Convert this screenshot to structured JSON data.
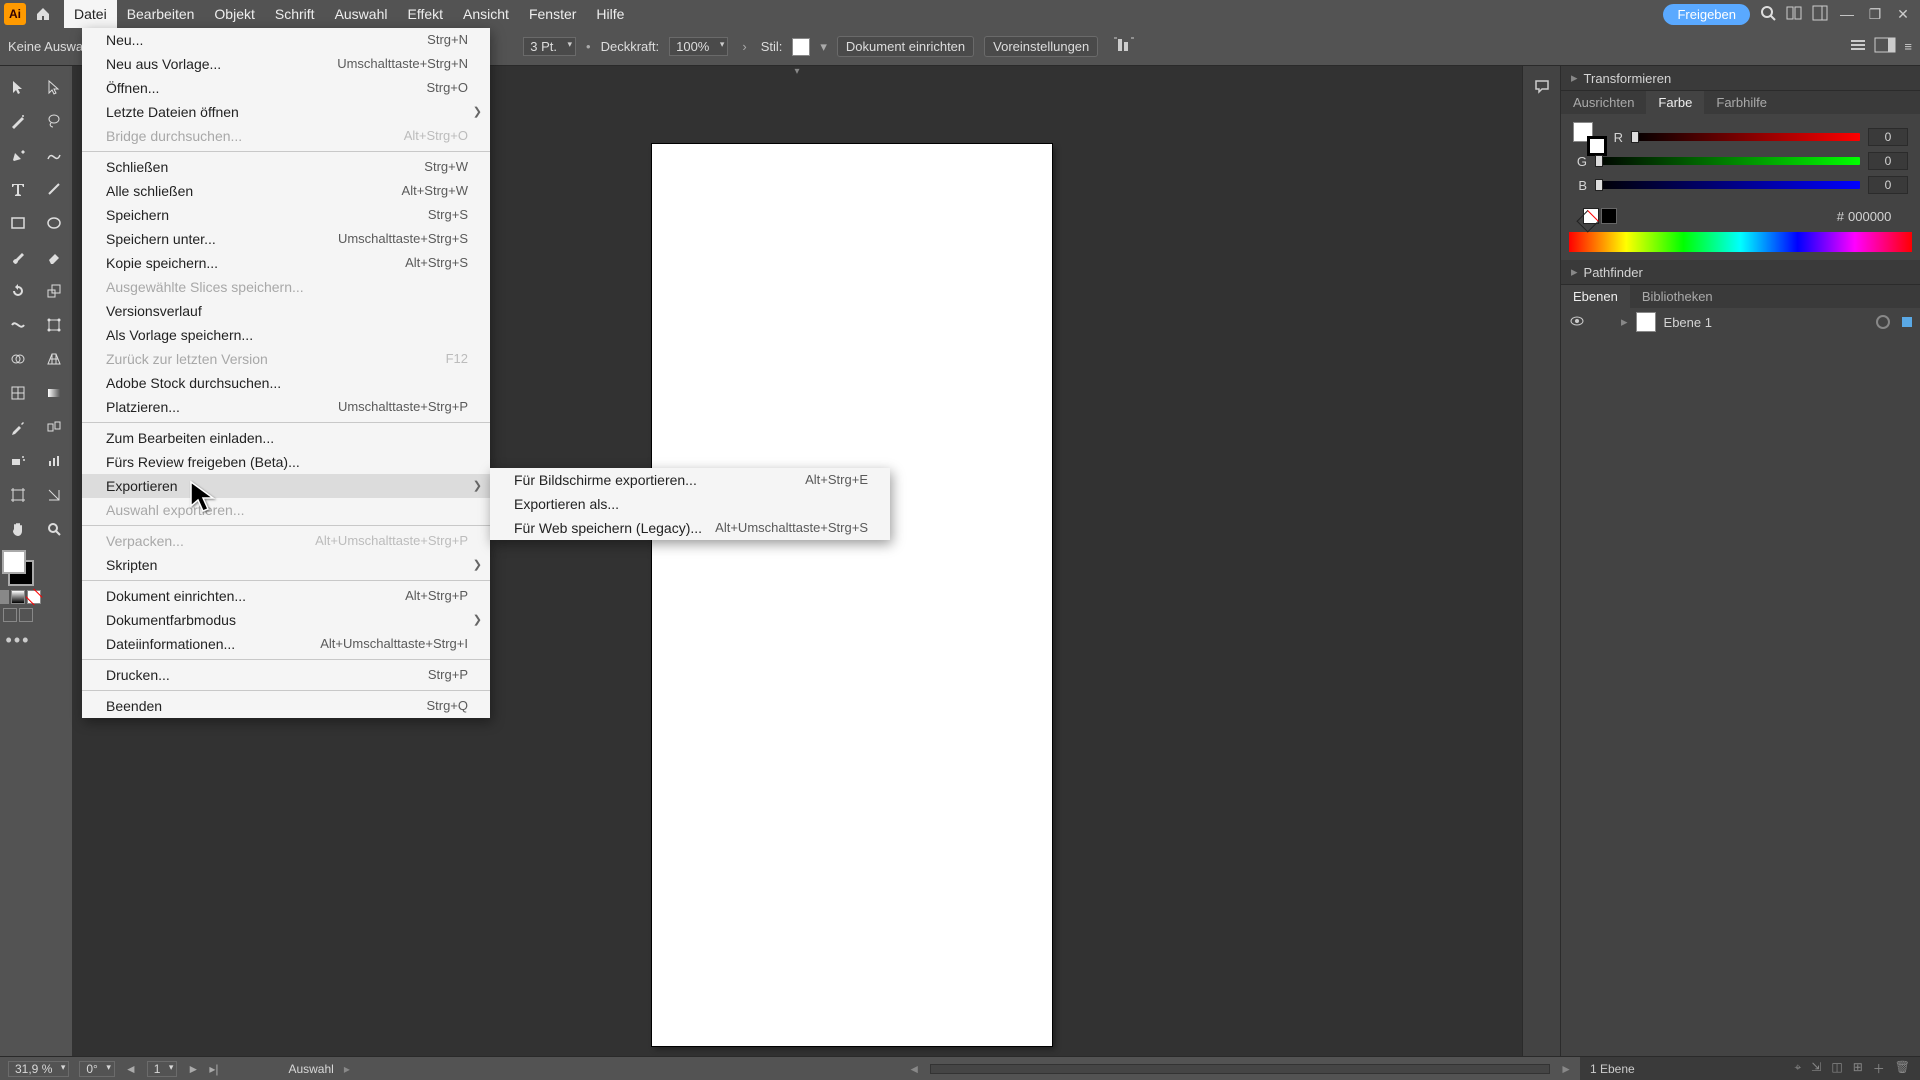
{
  "menubar": {
    "items": [
      "Datei",
      "Bearbeiten",
      "Objekt",
      "Schrift",
      "Auswahl",
      "Effekt",
      "Ansicht",
      "Fenster",
      "Hilfe"
    ],
    "share_label": "Freigeben"
  },
  "controlbar": {
    "no_selection": "Keine Auswahl",
    "stroke_val": "3 Pt.",
    "opacity_label": "Deckkraft:",
    "opacity_val": "100%",
    "style_label": "Stil:",
    "doc_setup": "Dokument einrichten",
    "prefs": "Voreinstellungen"
  },
  "file_menu": [
    {
      "label": "Neu...",
      "short": "Strg+N"
    },
    {
      "label": "Neu aus Vorlage...",
      "short": "Umschalttaste+Strg+N"
    },
    {
      "label": "Öffnen...",
      "short": "Strg+O"
    },
    {
      "label": "Letzte Dateien öffnen",
      "short": "",
      "sub": true
    },
    {
      "label": "Bridge durchsuchen...",
      "short": "Alt+Strg+O",
      "disabled": true
    },
    {
      "sep": true
    },
    {
      "label": "Schließen",
      "short": "Strg+W"
    },
    {
      "label": "Alle schließen",
      "short": "Alt+Strg+W"
    },
    {
      "label": "Speichern",
      "short": "Strg+S"
    },
    {
      "label": "Speichern unter...",
      "short": "Umschalttaste+Strg+S"
    },
    {
      "label": "Kopie speichern...",
      "short": "Alt+Strg+S"
    },
    {
      "label": "Ausgewählte Slices speichern...",
      "short": "",
      "disabled": true
    },
    {
      "label": "Versionsverlauf",
      "short": ""
    },
    {
      "label": "Als Vorlage speichern...",
      "short": ""
    },
    {
      "label": "Zurück zur letzten Version",
      "short": "F12",
      "disabled": true
    },
    {
      "label": "Adobe Stock durchsuchen...",
      "short": ""
    },
    {
      "label": "Platzieren...",
      "short": "Umschalttaste+Strg+P"
    },
    {
      "sep": true
    },
    {
      "label": "Zum Bearbeiten einladen...",
      "short": ""
    },
    {
      "label": "Fürs Review freigeben (Beta)...",
      "short": ""
    },
    {
      "label": "Exportieren",
      "short": "",
      "sub": true,
      "hl": true
    },
    {
      "label": "Auswahl exportieren...",
      "short": "",
      "disabled": true
    },
    {
      "sep": true
    },
    {
      "label": "Verpacken...",
      "short": "Alt+Umschalttaste+Strg+P",
      "disabled": true
    },
    {
      "label": "Skripten",
      "short": "",
      "sub": true
    },
    {
      "sep": true
    },
    {
      "label": "Dokument einrichten...",
      "short": "Alt+Strg+P"
    },
    {
      "label": "Dokumentfarbmodus",
      "short": "",
      "sub": true
    },
    {
      "label": "Dateiinformationen...",
      "short": "Alt+Umschalttaste+Strg+I"
    },
    {
      "sep": true
    },
    {
      "label": "Drucken...",
      "short": "Strg+P"
    },
    {
      "sep": true
    },
    {
      "label": "Beenden",
      "short": "Strg+Q"
    }
  ],
  "export_sub": [
    {
      "label": "Für Bildschirme exportieren...",
      "short": "Alt+Strg+E"
    },
    {
      "label": "Exportieren als...",
      "short": ""
    },
    {
      "label": "Für Web speichern (Legacy)...",
      "short": "Alt+Umschalttaste+Strg+S"
    }
  ],
  "panels": {
    "transform": "Transformieren",
    "align": "Ausrichten",
    "color": "Farbe",
    "colorguide": "Farbhilfe",
    "pathfinder": "Pathfinder",
    "layers": "Ebenen",
    "libraries": "Bibliotheken",
    "r": "R",
    "g": "G",
    "b": "B",
    "r_val": "0",
    "g_val": "0",
    "b_val": "0",
    "hex_sym": "#",
    "hex": "000000",
    "layer1": "Ebene 1",
    "layer_count": "1 Ebene"
  },
  "status": {
    "zoom": "31,9 %",
    "rotate": "0°",
    "artboard": "1",
    "tool": "Auswahl"
  }
}
